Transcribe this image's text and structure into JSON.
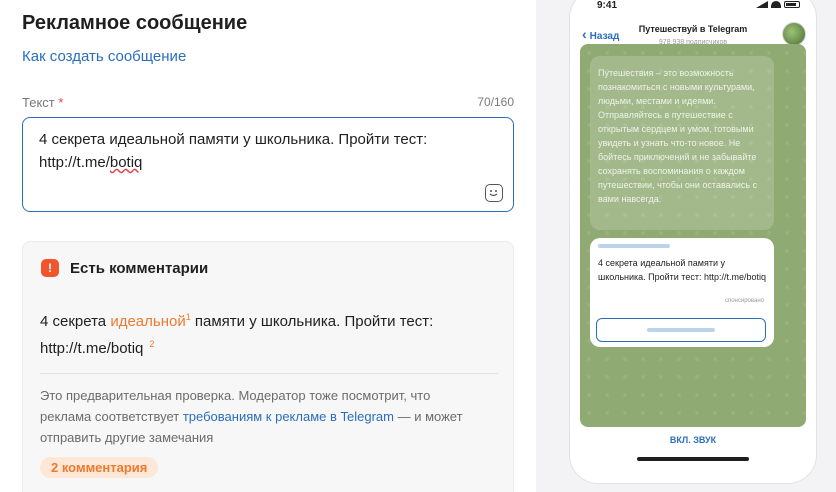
{
  "form": {
    "title": "Рекламное сообщение",
    "howto_link": "Как создать сообщение",
    "text_label": "Текст",
    "required_mark": "*",
    "counter": "70/160",
    "text_line1": "4 секрета идеальной памяти у школьника. Пройти тест:",
    "text_line2_prefix": "http://t.me/",
    "text_line2_underlined": "botiq"
  },
  "comments": {
    "title": "Есть комментарии",
    "warn_glyph": "!",
    "preview_part1": "4 секрета ",
    "preview_highlight": "идеальной",
    "preview_note1": "1",
    "preview_part2": " памяти у школьника. Пройти тест:",
    "preview_link": "http://t.me/botiq",
    "preview_note2": "2",
    "info_before": "Это предварительная проверка. Модератор тоже посмотрит, что реклама соответствует ",
    "info_link": "требованиям к рекламе в Telegram",
    "info_after": " — и может отправить другие замечания",
    "badge": "2 комментария"
  },
  "phone": {
    "time": "9:41",
    "back_label": "Назад",
    "channel_name": "Путешествуй в Telegram",
    "subscribers": "978 938 подписчиков",
    "post_text": "Путешествия – это возможность познакомиться с новыми культурами, людьми, местами и идеями. Отправляйтесь в путешествие с открытым сердцем и умом, готовыми увидеть и узнать что-то новое. Не бойтесь приключений и не забывайте сохранять воспоминания о каждом путешествии, чтобы они оставались с вами навсегда.",
    "ad_text": "4 секрета идеальной памяти у школьника. Пройти тест: http://t.me/botiq",
    "sponsored": "спонсировано",
    "sound_button": "ВКЛ. ЗВУК"
  },
  "colors": {
    "accent": "#2a6ebb",
    "warning": "#f0552b",
    "highlight": "#ec7a2f",
    "chat_bg": "#8faa72"
  },
  "icons": [
    "emoji-picker-icon",
    "warning-icon",
    "chevron-left-icon",
    "signal-icon",
    "wifi-icon",
    "battery-icon",
    "channel-avatar"
  ]
}
